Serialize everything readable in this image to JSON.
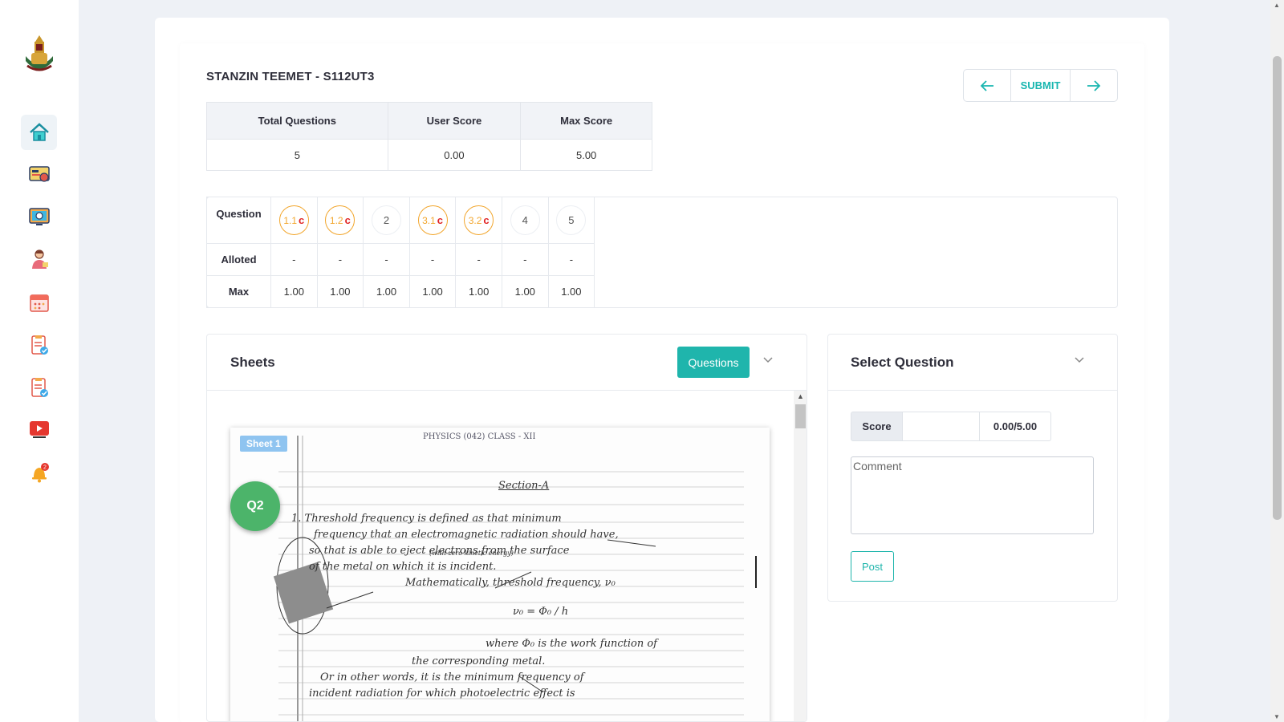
{
  "sidebar": {
    "items": [
      {
        "icon": "home-icon"
      },
      {
        "icon": "dashboard-report-icon"
      },
      {
        "icon": "monitor-camera-icon"
      },
      {
        "icon": "teacher-icon"
      },
      {
        "icon": "calendar-icon"
      },
      {
        "icon": "checklist-icon"
      },
      {
        "icon": "checklist-verified-icon"
      },
      {
        "icon": "video-play-icon"
      },
      {
        "icon": "notification-bell-icon",
        "badge": "2"
      }
    ]
  },
  "header": {
    "student_title": "STANZIN TEEMET - S112UT3",
    "submit_label": "SUBMIT"
  },
  "summary": {
    "headers": [
      "Total Questions",
      "User Score",
      "Max Score"
    ],
    "values": [
      "5",
      "0.00",
      "5.00"
    ]
  },
  "question_grid": {
    "row_labels": [
      "Question",
      "Alloted",
      "Max"
    ],
    "questions": [
      {
        "label": "1.1",
        "flag": "c",
        "done": true,
        "alloted": "-",
        "max": "1.00"
      },
      {
        "label": "1.2",
        "flag": "c",
        "done": true,
        "alloted": "-",
        "max": "1.00"
      },
      {
        "label": "2",
        "flag": "",
        "done": false,
        "alloted": "-",
        "max": "1.00"
      },
      {
        "label": "3.1",
        "flag": "c",
        "done": true,
        "alloted": "-",
        "max": "1.00"
      },
      {
        "label": "3.2",
        "flag": "c",
        "done": true,
        "alloted": "-",
        "max": "1.00"
      },
      {
        "label": "4",
        "flag": "",
        "done": false,
        "alloted": "-",
        "max": "1.00"
      },
      {
        "label": "5",
        "flag": "",
        "done": false,
        "alloted": "-",
        "max": "1.00"
      }
    ]
  },
  "sheets": {
    "title": "Sheets",
    "questions_button": "Questions",
    "sheet_label": "Sheet 1",
    "question_badge": "Q2",
    "handwriting": {
      "header": "PHYSICS (042) CLASS - XII",
      "section": "Section-A",
      "lines": [
        "1. Threshold frequency is defined as that minimum",
        "frequency that an electromagnetic radiation should have,",
        "so that is able to eject electrons from the surface",
        "of the metal on which it is incident.",
        "(with zero kinetic energy)",
        "Mathematically, threshold frequency, ν₀",
        "ν₀ = Φ₀ / h",
        "where Φ₀ is the work function of",
        "the corresponding metal.",
        "Or in other words, it is the minimum frequency of",
        "incident radiation for which photoelectric effect is"
      ]
    }
  },
  "select_question": {
    "title": "Select Question",
    "score_label": "Score",
    "score_value": "",
    "score_max": "0.00/5.00",
    "comment_placeholder": "Comment",
    "post_label": "Post"
  },
  "colors": {
    "accent": "#1fb5ac",
    "done_ring": "#f2a62d",
    "flag": "#e02424",
    "badge_green": "#4cb46a"
  }
}
